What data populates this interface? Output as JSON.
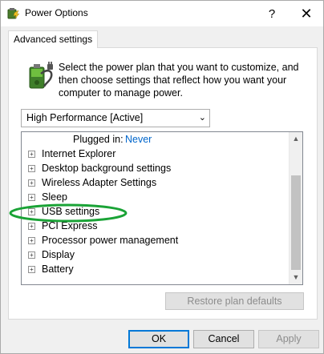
{
  "window": {
    "title": "Power Options",
    "help_glyph": "?",
    "close_glyph": "✕"
  },
  "tab": {
    "label": "Advanced settings"
  },
  "description": "Select the power plan that you want to customize, and then choose settings that reflect how you want your computer to manage power.",
  "plan_select": {
    "value": "High Performance [Active]"
  },
  "tree": {
    "plugged_label": "Plugged in:",
    "plugged_value": "Never",
    "items": [
      {
        "label": "Internet Explorer"
      },
      {
        "label": "Desktop background settings"
      },
      {
        "label": "Wireless Adapter Settings"
      },
      {
        "label": "Sleep"
      },
      {
        "label": "USB settings"
      },
      {
        "label": "PCI Express"
      },
      {
        "label": "Processor power management"
      },
      {
        "label": "Display"
      },
      {
        "label": "Battery"
      }
    ]
  },
  "buttons": {
    "restore": "Restore plan defaults",
    "ok": "OK",
    "cancel": "Cancel",
    "apply": "Apply"
  },
  "colors": {
    "annotation": "#1aa336",
    "link": "#0066cc",
    "accent": "#0078d7"
  }
}
